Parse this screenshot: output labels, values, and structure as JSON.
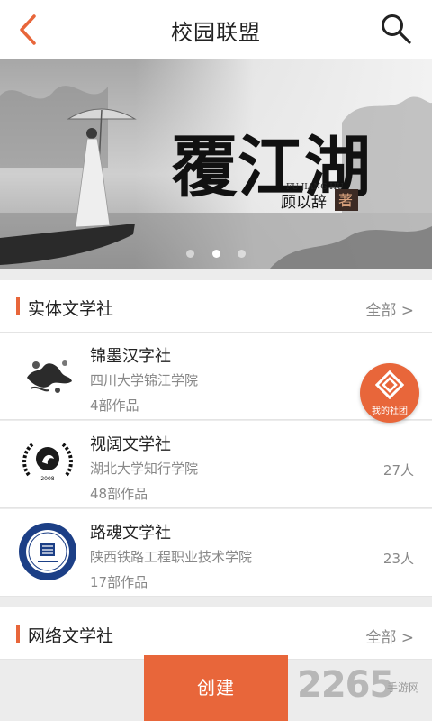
{
  "header": {
    "title": "校园联盟"
  },
  "banner": {
    "calligraphy": "覆江湖",
    "pinyin": "FU JIANG HU",
    "author": "顾以辞",
    "seal": "著",
    "page_count": 3,
    "active_index": 1
  },
  "sections": [
    {
      "label": "实体文学社",
      "more": "全部 >",
      "clubs": [
        {
          "name": "锦墨汉字社",
          "school": "四川大学锦江学院",
          "works": "4部作品",
          "members": ""
        },
        {
          "name": "视阔文学社",
          "school": "湖北大学知行学院",
          "works": "48部作品",
          "members": "27人"
        },
        {
          "name": "路魂文学社",
          "school": "陕西铁路工程职业技术学院",
          "works": "17部作品",
          "members": "23人"
        }
      ]
    },
    {
      "label": "网络文学社",
      "more": "全部 >"
    }
  ],
  "fab": {
    "label": "我的社团"
  },
  "bottom": {
    "create_label": "创建"
  },
  "watermark": {
    "number": "2265",
    "site": "手游网"
  },
  "logos": {
    "club2_year": "2008"
  },
  "colors": {
    "accent": "#e8663a",
    "text_primary": "#222222",
    "text_secondary": "#888888"
  }
}
